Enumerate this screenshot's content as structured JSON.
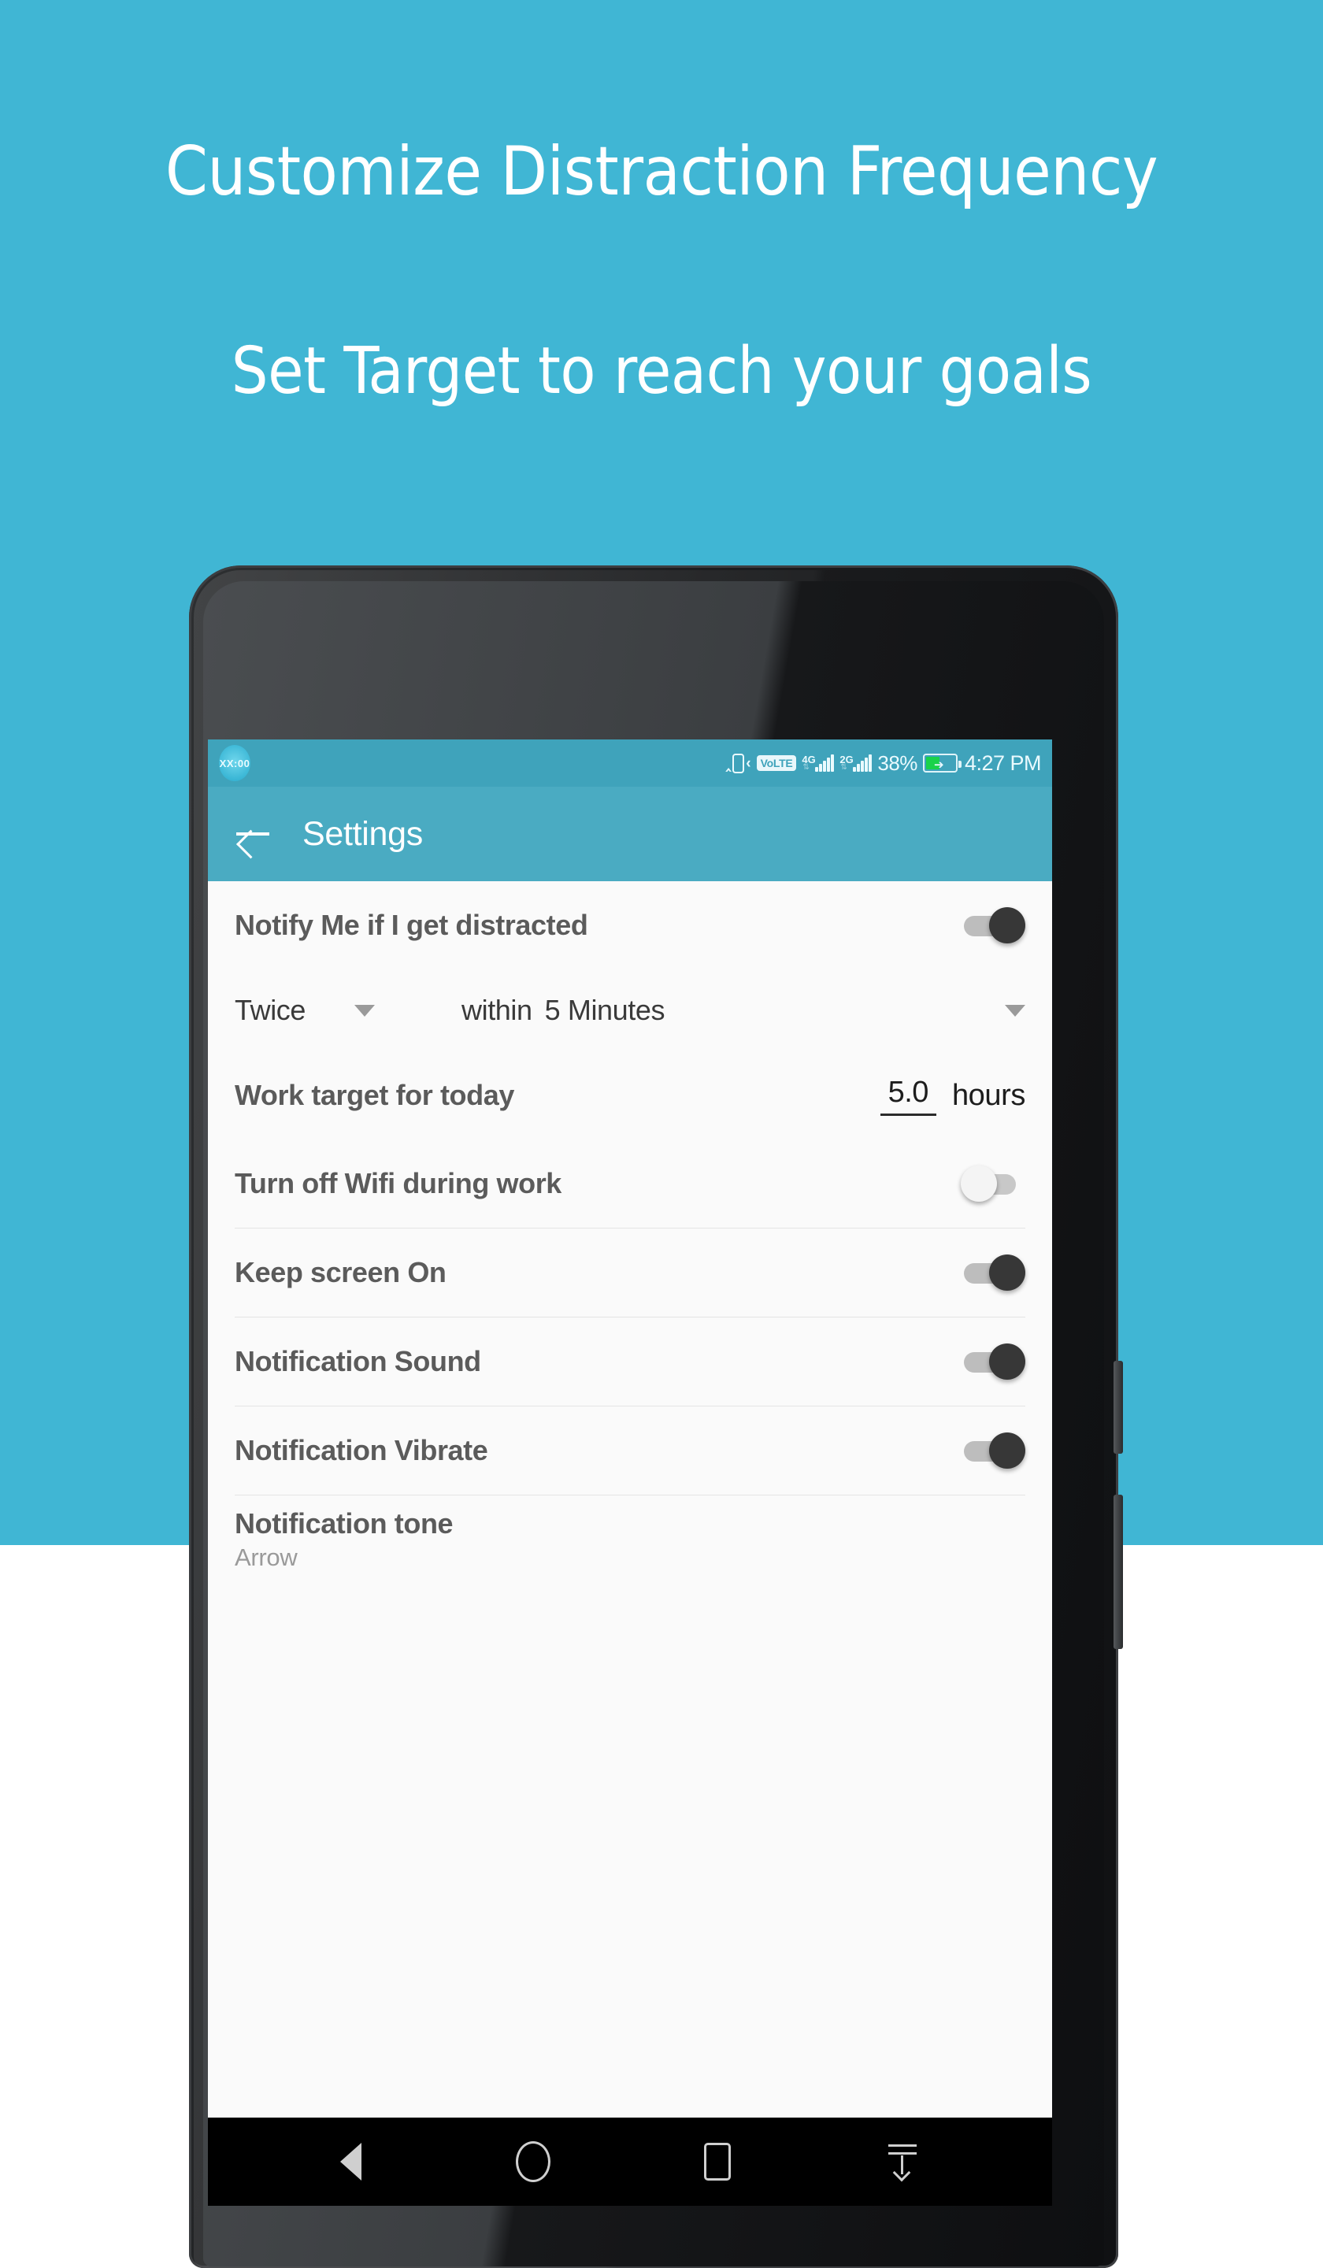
{
  "promo": {
    "background_color": "#40b6d4",
    "line1": "Customize Distraction Frequency",
    "line2": "Set Target to reach your goals"
  },
  "phone": {
    "statusbar": {
      "notification_badge": "XX:00",
      "vibrate_icon": "vibrate-icon",
      "volte_badge": "VoLTE",
      "sim1_network": "4G",
      "sim2_network": "2G",
      "battery_percent": "38%",
      "battery_state": "charging",
      "time": "4:27 PM",
      "background_color": "#3fa3bb"
    },
    "appbar": {
      "back_label": "back-arrow",
      "title": "Settings",
      "background_color": "#4aabc2"
    },
    "settings": {
      "notify": {
        "label": "Notify Me if I get distracted",
        "toggle": "on"
      },
      "frequency": {
        "count_value": "Twice",
        "joiner": "within",
        "interval_value": "5 Minutes"
      },
      "work_target": {
        "label": "Work target for today",
        "value": "5.0",
        "unit": "hours"
      },
      "wifi": {
        "label": "Turn off Wifi during work",
        "toggle": "off"
      },
      "keep_screen": {
        "label": "Keep screen On",
        "toggle": "on"
      },
      "notif_sound": {
        "label": "Notification Sound",
        "toggle": "on"
      },
      "notif_vibrate": {
        "label": "Notification Vibrate",
        "toggle": "on"
      },
      "notif_tone": {
        "label": "Notification tone",
        "value": "Arrow"
      }
    },
    "navbar": {
      "back": "nav-back-icon",
      "home": "nav-home-icon",
      "recents": "nav-recents-icon",
      "pulldown": "nav-pulldown-icon"
    }
  }
}
